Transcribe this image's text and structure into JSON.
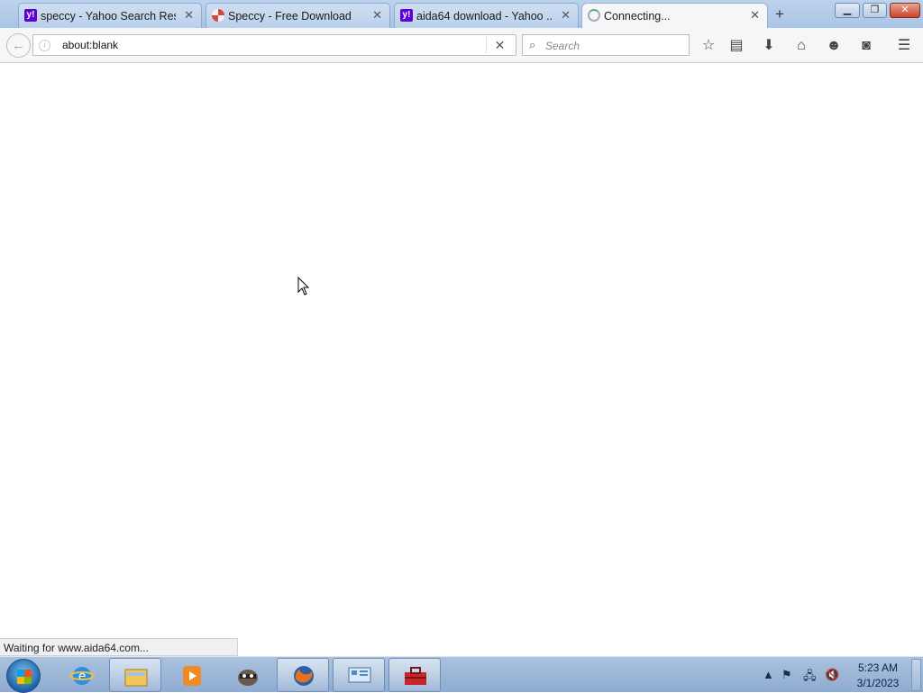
{
  "browser": {
    "tabs": [
      {
        "label": "speccy - Yahoo Search Res...",
        "favicon": "yahoo-icon",
        "state": "background"
      },
      {
        "label": "Speccy - Free Download",
        "favicon": "speccy-icon",
        "state": "background"
      },
      {
        "label": "aida64 download - Yahoo ...",
        "favicon": "yahoo-icon",
        "state": "background"
      },
      {
        "label": "Connecting...",
        "favicon": "loading-spinner-icon",
        "state": "active"
      }
    ],
    "new_tab_glyph": "+",
    "tab_close_glyph": "✕",
    "address": "about:blank",
    "search_placeholder": "Search",
    "status_text": "Waiting for www.aida64.com..."
  },
  "toolbar_icons": [
    "bookmark-star-icon",
    "reading-list-icon",
    "downloads-icon",
    "home-icon",
    "hello-icon",
    "pocket-icon",
    "menu-icon"
  ],
  "taskbar": {
    "pinned": [
      "internet-explorer-icon",
      "windows-explorer-icon",
      "media-player-icon",
      "raccoon-app-icon"
    ],
    "open": [
      "firefox-icon",
      "control-panel-icon",
      "toolbox-icon"
    ],
    "clock_time": "5:23 AM",
    "clock_date": "3/1/2023"
  },
  "colors": {
    "yahoo": "#5f01d1",
    "taskbar": "#9bb6d8",
    "close_button": "#c7442a"
  }
}
